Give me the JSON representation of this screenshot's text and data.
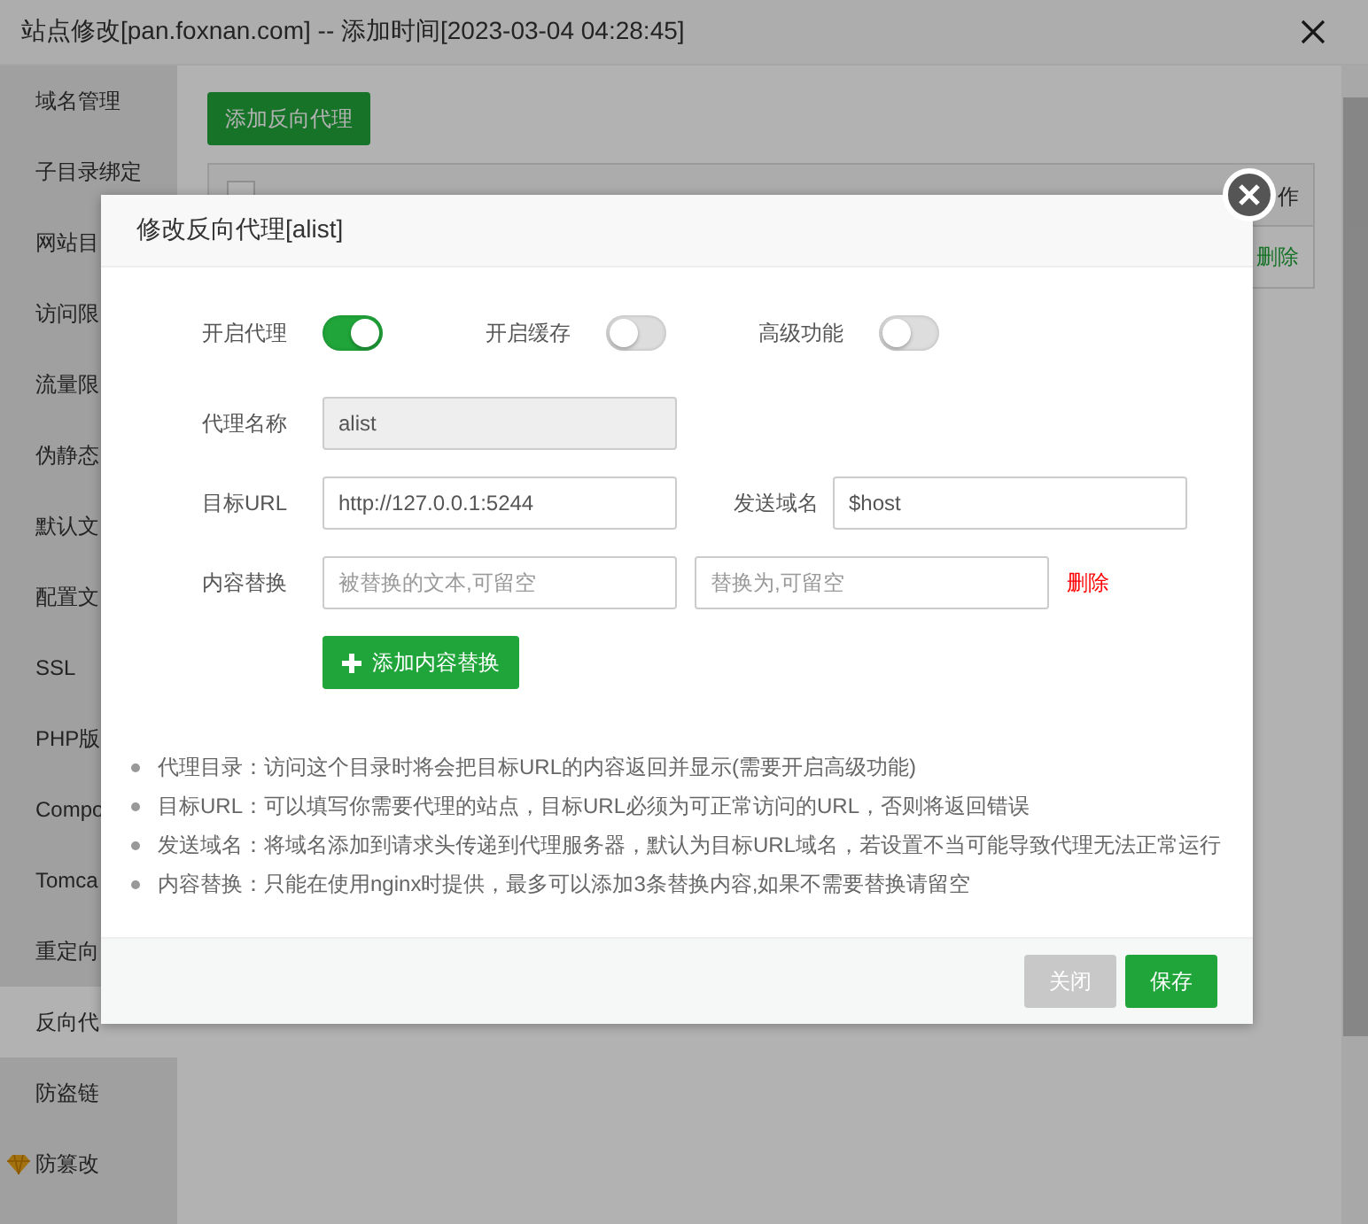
{
  "window": {
    "title": "站点修改[pan.foxnan.com] -- 添加时间[2023-03-04 04:28:45]"
  },
  "sidebar": {
    "items": [
      {
        "label": "域名管理",
        "selected": false,
        "premium": false
      },
      {
        "label": "子目录绑定",
        "selected": false,
        "premium": false
      },
      {
        "label": "网站目",
        "selected": false,
        "premium": false
      },
      {
        "label": "访问限",
        "selected": false,
        "premium": false
      },
      {
        "label": "流量限",
        "selected": false,
        "premium": false
      },
      {
        "label": "伪静态",
        "selected": false,
        "premium": false
      },
      {
        "label": "默认文",
        "selected": false,
        "premium": false
      },
      {
        "label": "配置文",
        "selected": false,
        "premium": false
      },
      {
        "label": "SSL",
        "selected": false,
        "premium": false
      },
      {
        "label": "PHP版",
        "selected": false,
        "premium": false
      },
      {
        "label": "Compo",
        "selected": false,
        "premium": false
      },
      {
        "label": "Tomca",
        "selected": false,
        "premium": false
      },
      {
        "label": "重定向",
        "selected": false,
        "premium": false
      },
      {
        "label": "反向代",
        "selected": true,
        "premium": false
      },
      {
        "label": "防盗链",
        "selected": false,
        "premium": false
      },
      {
        "label": "防篡改",
        "selected": false,
        "premium": true
      }
    ]
  },
  "main": {
    "add_button": "添加反向代理",
    "table": {
      "select_all_checked": false,
      "columns": [
        "作"
      ],
      "row_action": "删除"
    }
  },
  "modal": {
    "title": "修改反向代理[alist]",
    "toggles": [
      {
        "label": "开启代理",
        "on": true
      },
      {
        "label": "开启缓存",
        "on": false
      },
      {
        "label": "高级功能",
        "on": false
      }
    ],
    "proxy_name": {
      "label": "代理名称",
      "value": "alist",
      "disabled": true
    },
    "target_url": {
      "label": "目标URL",
      "value": "http://127.0.0.1:5244"
    },
    "send_domain": {
      "label": "发送域名",
      "value": "$host"
    },
    "replace": {
      "label": "内容替换",
      "placeholder_from": "被替换的文本,可留空",
      "placeholder_to": "替换为,可留空",
      "delete": "删除"
    },
    "add_replace_button": "添加内容替换",
    "tips": [
      "代理目录：访问这个目录时将会把目标URL的内容返回并显示(需要开启高级功能)",
      "目标URL：可以填写你需要代理的站点，目标URL必须为可正常访问的URL，否则将返回错误",
      "发送域名：将域名添加到请求头传递到代理服务器，默认为目标URL域名，若设置不当可能导致代理无法正常运行",
      "内容替换：只能在使用nginx时提供，最多可以添加3条替换内容,如果不需要替换请留空"
    ],
    "buttons": [
      {
        "label": "关闭",
        "kind": "secondary"
      },
      {
        "label": "保存",
        "kind": "primary"
      }
    ]
  }
}
